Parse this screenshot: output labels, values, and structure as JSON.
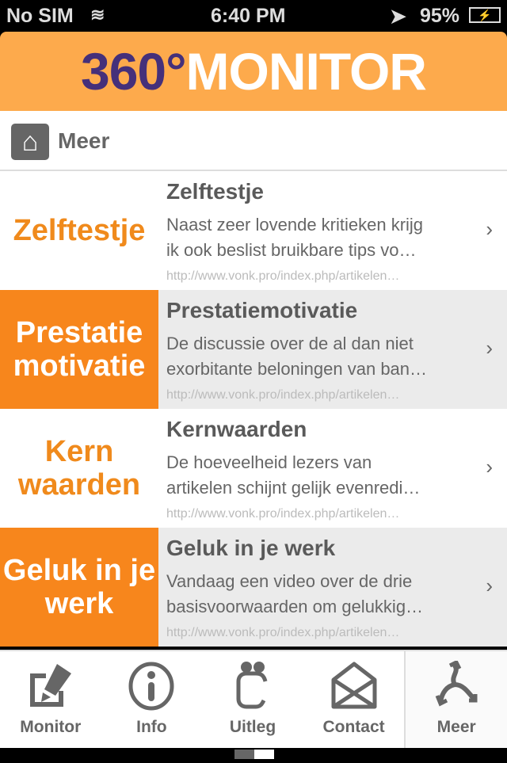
{
  "status": {
    "carrier": "No SIM",
    "time": "6:40 PM",
    "battery": "95%"
  },
  "header": {
    "logo_number": "360°",
    "logo_word": "MONITOR"
  },
  "breadcrumb": {
    "title": "Meer"
  },
  "items": [
    {
      "thumb": "Zelftestje",
      "title": "Zelftestje",
      "line1": "Naast zeer lovende kritieken krijg",
      "line2": "ik ook beslist bruikbare tips vo…",
      "url": "http://www.vonk.pro/index.php/artikelen…"
    },
    {
      "thumb": "Prestatie motivatie",
      "title": "Prestatiemotivatie",
      "line1": "De discussie over de al dan niet",
      "line2": "exorbitante beloningen van ban…",
      "url": "http://www.vonk.pro/index.php/artikelen…"
    },
    {
      "thumb": "Kern waarden",
      "title": "Kernwaarden",
      "line1": "De hoeveelheid lezers van",
      "line2": "artikelen schijnt gelijk evenredi…",
      "url": "http://www.vonk.pro/index.php/artikelen…"
    },
    {
      "thumb": "Geluk in je werk",
      "title": "Geluk in je werk",
      "line1": "Vandaag een video over de drie",
      "line2": "basisvoorwaarden om gelukkig…",
      "url": "http://www.vonk.pro/index.php/artikelen…"
    }
  ],
  "tabs": [
    {
      "label": "Monitor",
      "icon": "pen-icon"
    },
    {
      "label": "Info",
      "icon": "info-icon"
    },
    {
      "label": "Uitleg",
      "icon": "people-icon"
    },
    {
      "label": "Contact",
      "icon": "envelope-icon"
    },
    {
      "label": "Meer",
      "icon": "more-arrows-icon",
      "selected": true
    }
  ],
  "colors": {
    "header": "#fdaa4c",
    "accent": "#f7861c",
    "logo_number": "#45307a"
  }
}
